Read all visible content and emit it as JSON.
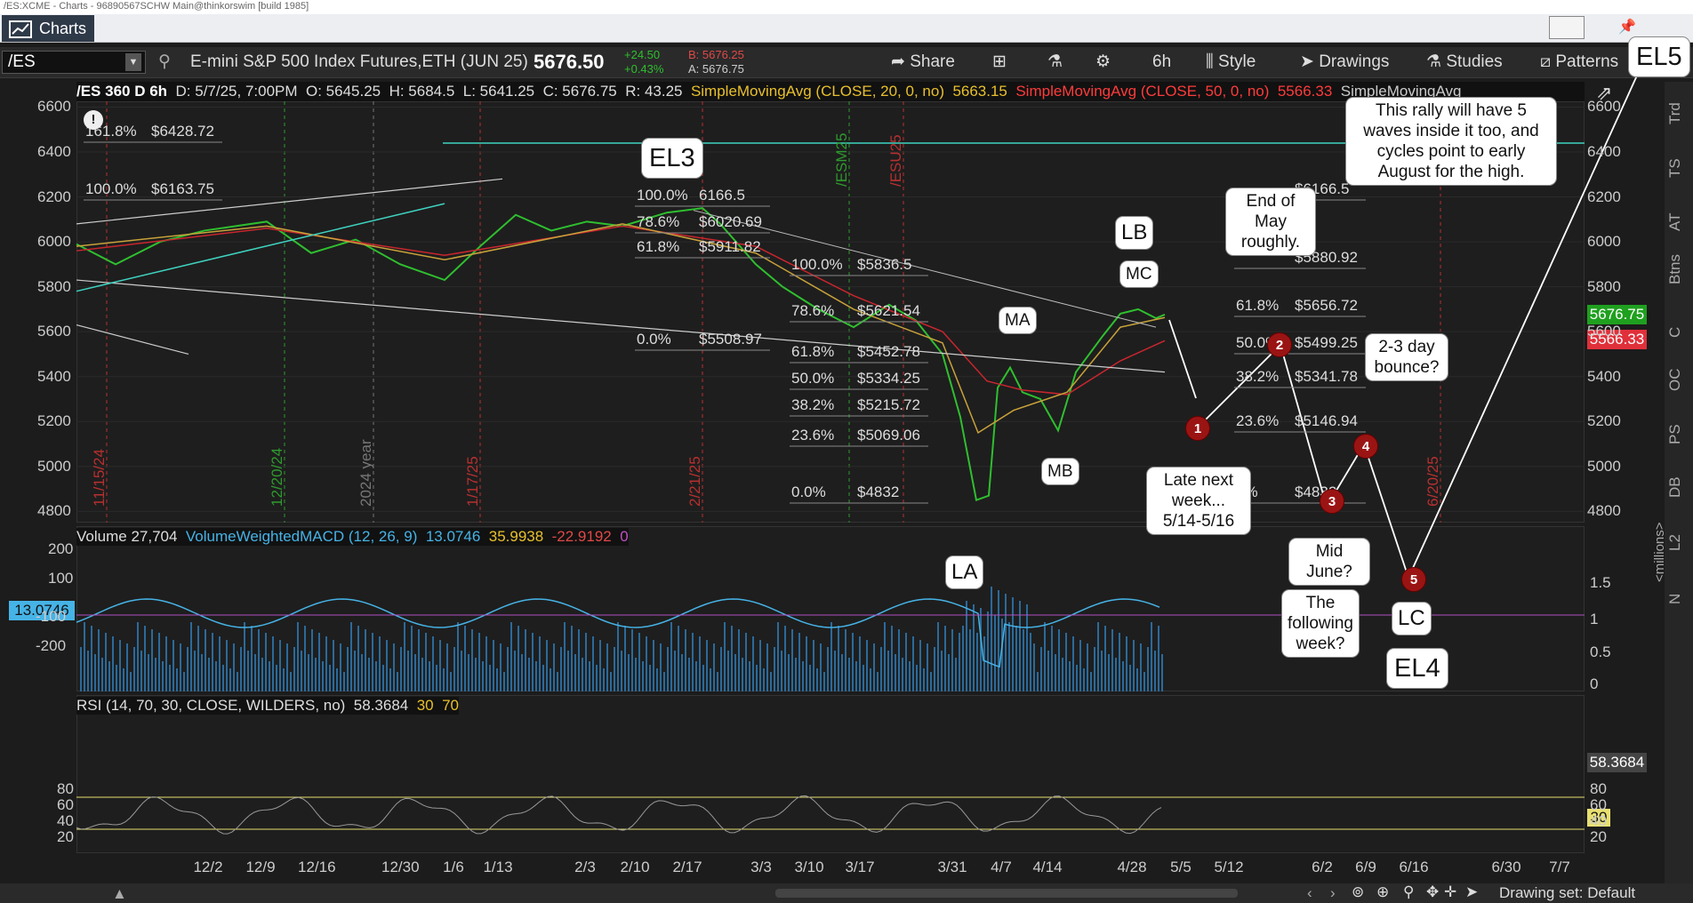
{
  "window": {
    "title": "/ES:XCME - Charts - 96890567SCHW Main@thinkorswim [build 1985]",
    "tab": "Charts"
  },
  "toolbar": {
    "symbol": "/ES",
    "description": "E-mini S&P 500 Index Futures,ETH (JUN 25)",
    "last": "5676.50",
    "change": "+24.50",
    "change_pct": "+0.43%",
    "bid": "B: 5676.25",
    "ask": "A: 5676.75",
    "share": "Share",
    "timeframe": "6h",
    "style": "Style",
    "drawings": "Drawings",
    "studies": "Studies",
    "patterns": "Patterns"
  },
  "info": {
    "symbol_label": "/ES 360 D 6h",
    "date": "D: 5/7/25, 7:00PM",
    "open": "O: 5645.25",
    "high": "H: 5684.5",
    "low": "L: 5641.25",
    "close": "C: 5676.75",
    "range": "R: 43.25",
    "sma20": "SimpleMovingAvg (CLOSE, 20, 0, no)",
    "sma20_val": "5663.15",
    "sma50": "SimpleMovingAvg (CLOSE, 50, 0, no)",
    "sma50_val": "5566.33",
    "sma_more": "SimpleMovingAvg"
  },
  "price_axis": [
    "6600",
    "6400",
    "6200",
    "6000",
    "5800",
    "5600",
    "5400",
    "5200",
    "5000",
    "4800"
  ],
  "price_tags": {
    "last": "5676.75",
    "sma50": "5566.33"
  },
  "volume": {
    "label": "Volume",
    "value": "27,704",
    "macd": "VolumeWeightedMACD (12, 26, 9)",
    "v1": "13.0746",
    "v2": "35.9938",
    "v3": "-22.9192",
    "v4": "0",
    "left_axis": [
      "200",
      "100",
      "-100",
      "-200"
    ],
    "left_tag": "13.0746",
    "right_axis": [
      "1.5",
      "1",
      "0.5",
      "0"
    ],
    "units": "<millions>"
  },
  "rsi": {
    "label": "RSI (14, 70, 30, CLOSE, WILDERS, no)",
    "value": "58.3684",
    "ob": "30",
    "os": "70",
    "axis": [
      "80",
      "60",
      "40",
      "20"
    ],
    "tag": "58.3684",
    "tag30": "30"
  },
  "date_axis": [
    "12/2",
    "12/9",
    "12/16",
    "12/30",
    "1/6",
    "1/13",
    "2/3",
    "2/10",
    "2/17",
    "3/3",
    "3/10",
    "3/17",
    "3/31",
    "4/7",
    "4/14",
    "4/28",
    "5/5",
    "5/12",
    "6/2",
    "6/9",
    "6/16",
    "6/30",
    "7/7"
  ],
  "vlines": [
    "11/15/24",
    "12/20/24",
    "2024 year",
    "1/17/25",
    "2/21/25",
    "/ESM25",
    "/ESU25",
    "6/20/25"
  ],
  "fib_left": [
    [
      "161.8%",
      "$6428.72"
    ],
    [
      "100.0%",
      "$6163.75"
    ]
  ],
  "fib_mid": [
    [
      "100.0%",
      "6166.5"
    ],
    [
      "78.6%",
      "$6020.69"
    ],
    [
      "61.8%",
      "$5911.82"
    ],
    [
      "0.0%",
      "$5508.97"
    ]
  ],
  "fib_center": [
    [
      "100.0%",
      "$5836.5"
    ],
    [
      "78.6%",
      "$5621.54"
    ],
    [
      "61.8%",
      "$5452.78"
    ],
    [
      "50.0%",
      "$5334.25"
    ],
    [
      "38.2%",
      "$5215.72"
    ],
    [
      "23.6%",
      "$5069.06"
    ],
    [
      "0.0%",
      "$4832"
    ]
  ],
  "fib_right": [
    [
      "",
      "$6166.5"
    ],
    [
      "",
      "$5880.92"
    ],
    [
      "61.8%",
      "$5656.72"
    ],
    [
      "50.0%",
      "$5499.25"
    ],
    [
      "38.2%",
      "$5341.78"
    ],
    [
      "23.6%",
      "$5146.94"
    ],
    [
      "0%",
      "$4832"
    ]
  ],
  "notes": {
    "el3": "EL3",
    "el4": "EL4",
    "el5": "EL5",
    "lb": "LB",
    "mc": "MC",
    "ma": "MA",
    "mb": "MB",
    "la": "LA",
    "lc": "LC",
    "end_may": "End of May roughly.",
    "late_week": "Late next week... 5/14-5/16",
    "mid_june": "Mid June?",
    "bounce": "2-3 day bounce?",
    "following": "The following week?",
    "rally": "This rally will have 5 waves inside it too, and cycles point to early August for the high."
  },
  "waves": [
    "1",
    "2",
    "3",
    "4",
    "5"
  ],
  "sidebar": [
    "Trd",
    "TS",
    "AT",
    "Btns",
    "C",
    "OC",
    "PS",
    "DB",
    "L2",
    "N"
  ],
  "status": {
    "drawing_set": "Drawing set: Default"
  },
  "colors": {
    "up": "#2fbf2f",
    "down": "#e04848",
    "sma20": "#c8a23a",
    "sma50": "#c8262e",
    "sma_gray": "#aaaaaa",
    "teal": "#3fd3c0",
    "macd": "#46b3e6"
  }
}
